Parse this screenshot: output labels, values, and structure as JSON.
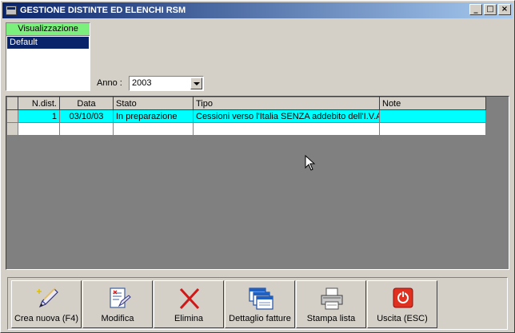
{
  "window": {
    "title": "GESTIONE DISTINTE ED ELENCHI RSM",
    "min_glyph": "_",
    "max_glyph": "□",
    "close_glyph": "×"
  },
  "view_panel": {
    "header": "Visualizzazione",
    "items": [
      "Default"
    ]
  },
  "anno": {
    "label": "Anno :",
    "value": "2003"
  },
  "grid": {
    "columns": [
      "N.dist.",
      "Data",
      "Stato",
      "Tipo",
      "Note"
    ],
    "rows": [
      {
        "n_dist": "1",
        "data": "03/10/03",
        "stato": "In preparazione",
        "tipo": "Cessioni verso l'Italia SENZA addebito dell'I.V.A.",
        "note": ""
      }
    ]
  },
  "toolbar": {
    "buttons": [
      {
        "label": "Crea nuova (F4)",
        "icon": "pencil-new-icon"
      },
      {
        "label": "Modifica",
        "icon": "edit-document-icon"
      },
      {
        "label": "Elimina",
        "icon": "delete-x-icon"
      },
      {
        "label": "Dettaglio fatture",
        "icon": "windows-detail-icon"
      },
      {
        "label": "Stampa lista",
        "icon": "printer-icon"
      },
      {
        "label": "Uscita (ESC)",
        "icon": "exit-power-icon"
      }
    ]
  },
  "colors": {
    "selected_row": "#00ffff",
    "view_header": "#7cf07c",
    "title_bar": "#0a246a"
  }
}
